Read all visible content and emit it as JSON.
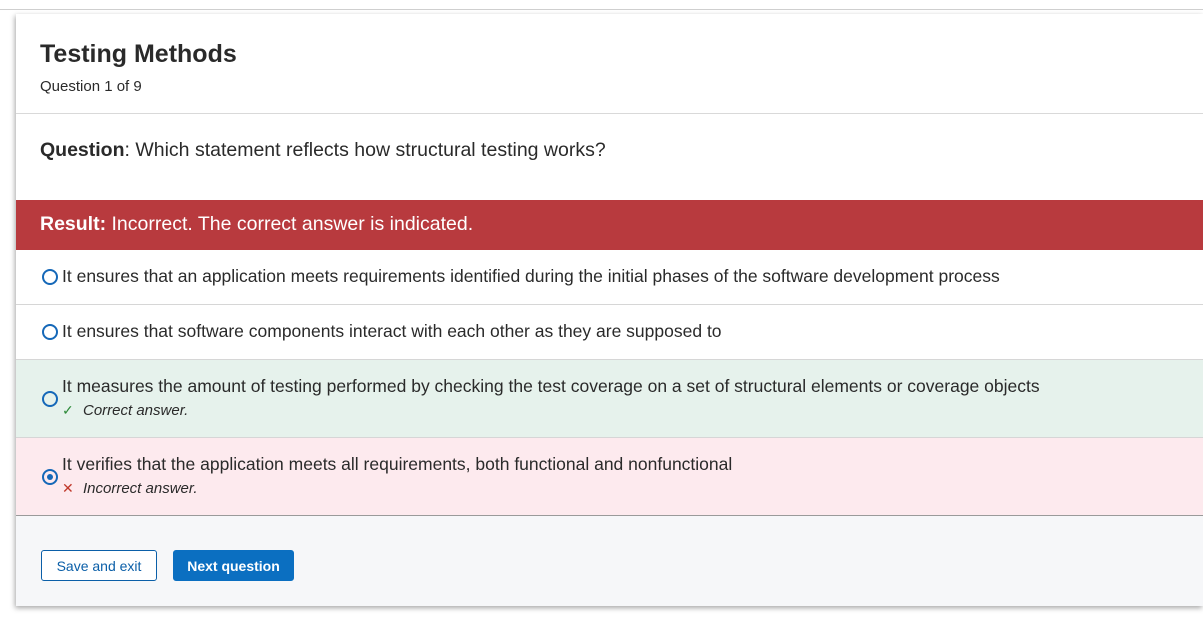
{
  "quiz": {
    "title": "Testing Methods",
    "progress": "Question 1 of 9"
  },
  "question": {
    "label": "Question",
    "text": ": Which statement reflects how structural testing works?"
  },
  "result": {
    "label": "Result:",
    "text": " Incorrect. The correct answer is indicated.",
    "color": "#b83a3e"
  },
  "options": [
    {
      "text": "It ensures that an application meets requirements identified during the initial phases of the software development process",
      "selected": false,
      "status": "none"
    },
    {
      "text": "It ensures that software components interact with each other as they are supposed to",
      "selected": false,
      "status": "none"
    },
    {
      "text": "It measures the amount of testing performed by checking the test coverage on a set of structural elements or coverage objects",
      "selected": false,
      "status": "correct",
      "feedback": "Correct answer.",
      "feedback_icon": "checkmark-icon"
    },
    {
      "text": "It verifies that the application meets all requirements, both functional and nonfunctional",
      "selected": true,
      "status": "incorrect",
      "feedback": "Incorrect answer.",
      "feedback_icon": "x-mark-icon"
    }
  ],
  "actions": {
    "save_exit_label": "Save and exit",
    "next_label": "Next question"
  },
  "colors": {
    "accent": "#0b6fc1",
    "correct_bg": "#e6f2ec",
    "incorrect_bg": "#fdeaee"
  }
}
